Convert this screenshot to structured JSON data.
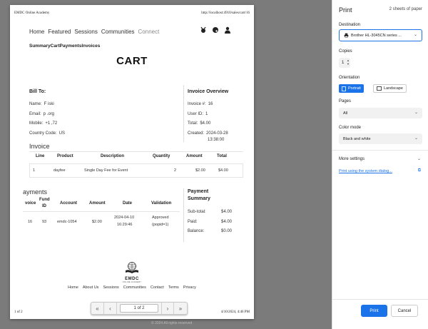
{
  "page": {
    "header_left": "EMDC Online Academy",
    "header_right": "http://localhost:4910/sales/cart/16",
    "nav": [
      "Home",
      "Featured",
      "Sessions",
      "Communities",
      "Connect"
    ],
    "subnav": "SummaryCartPaymentsInvoices",
    "title": "CART",
    "bill_to": {
      "heading": "Bill To:",
      "name_label": "Name:",
      "name_value": "F                              iski",
      "email_label": "Email:",
      "email_value": "p                               .org",
      "mobile_label": "Mobile:",
      "mobile_value": "+1         ,72",
      "country_label": "Country Code:",
      "country_value": "US"
    },
    "invoice_overview": {
      "heading": "Invoice Overview",
      "invoice_label": "Invoice #:",
      "invoice_value": "16",
      "user_label": "User ID:",
      "user_value": "1",
      "total_label": "Total:",
      "total_value": "$4.00",
      "created_label": "Created:",
      "created_value_1": "2024-03-28",
      "created_value_2": "13:38:00"
    },
    "invoice_table": {
      "heading": "Invoice",
      "columns": [
        "Line",
        "Product",
        "Description",
        "Quantity",
        "Amount",
        "Total"
      ],
      "row": [
        "1",
        "dayfee",
        "Single Day Fee for Event",
        "2",
        "$2.00",
        "$4.00"
      ]
    },
    "payments_table": {
      "heading": "ayments",
      "columns": [
        "voice",
        "Fund",
        "ID",
        "Account",
        "Amount",
        "Date",
        "Validation"
      ],
      "row": [
        "16",
        "93",
        "emdc-1054",
        "$2.00",
        "2024-04-10",
        "16:29:46",
        "Approved",
        "(popid=1)"
      ]
    },
    "payment_summary": {
      "heading_1": "Payment",
      "heading_2": "Summary",
      "subtotal_label": "Sub-total:",
      "subtotal_value": "$4.00",
      "paid_label": "Paid:",
      "paid_value": "$4.00",
      "balance_label": "Balance:",
      "balance_value": "$0.00"
    },
    "logo_text": "EMDC",
    "logo_sub": "ONLINE ACADEMY",
    "footer_links": [
      "Home",
      "About Us",
      "Sessions",
      "Communities",
      "Contact",
      "Terms",
      "Privacy"
    ],
    "footer_left": "1 of 2",
    "footer_right": "4/10/2024, 4:46 PM"
  },
  "page_nav": {
    "first": "«",
    "prev": "‹",
    "page_text": "1 of 2",
    "next": "›",
    "last": "»"
  },
  "below_text": "© 2024 All rights reserved",
  "dialog": {
    "title": "Print",
    "sheets": "2 sheets of paper",
    "destination_label": "Destination",
    "destination_value": "Brother HL-3045CN series ...",
    "copies_label": "Copies",
    "copies_value": "1",
    "orientation_label": "Orientation",
    "portrait": "Portrait",
    "landscape": "Landscape",
    "pages_label": "Pages",
    "pages_value": "All",
    "color_label": "Color mode",
    "color_value": "Black and white",
    "more_settings": "More settings",
    "system_dialog": "Print using the system dialog...",
    "print": "Print",
    "cancel": "Cancel"
  },
  "colors": {
    "accent": "#1a73e8",
    "preview_bg": "#7b7b7b"
  }
}
